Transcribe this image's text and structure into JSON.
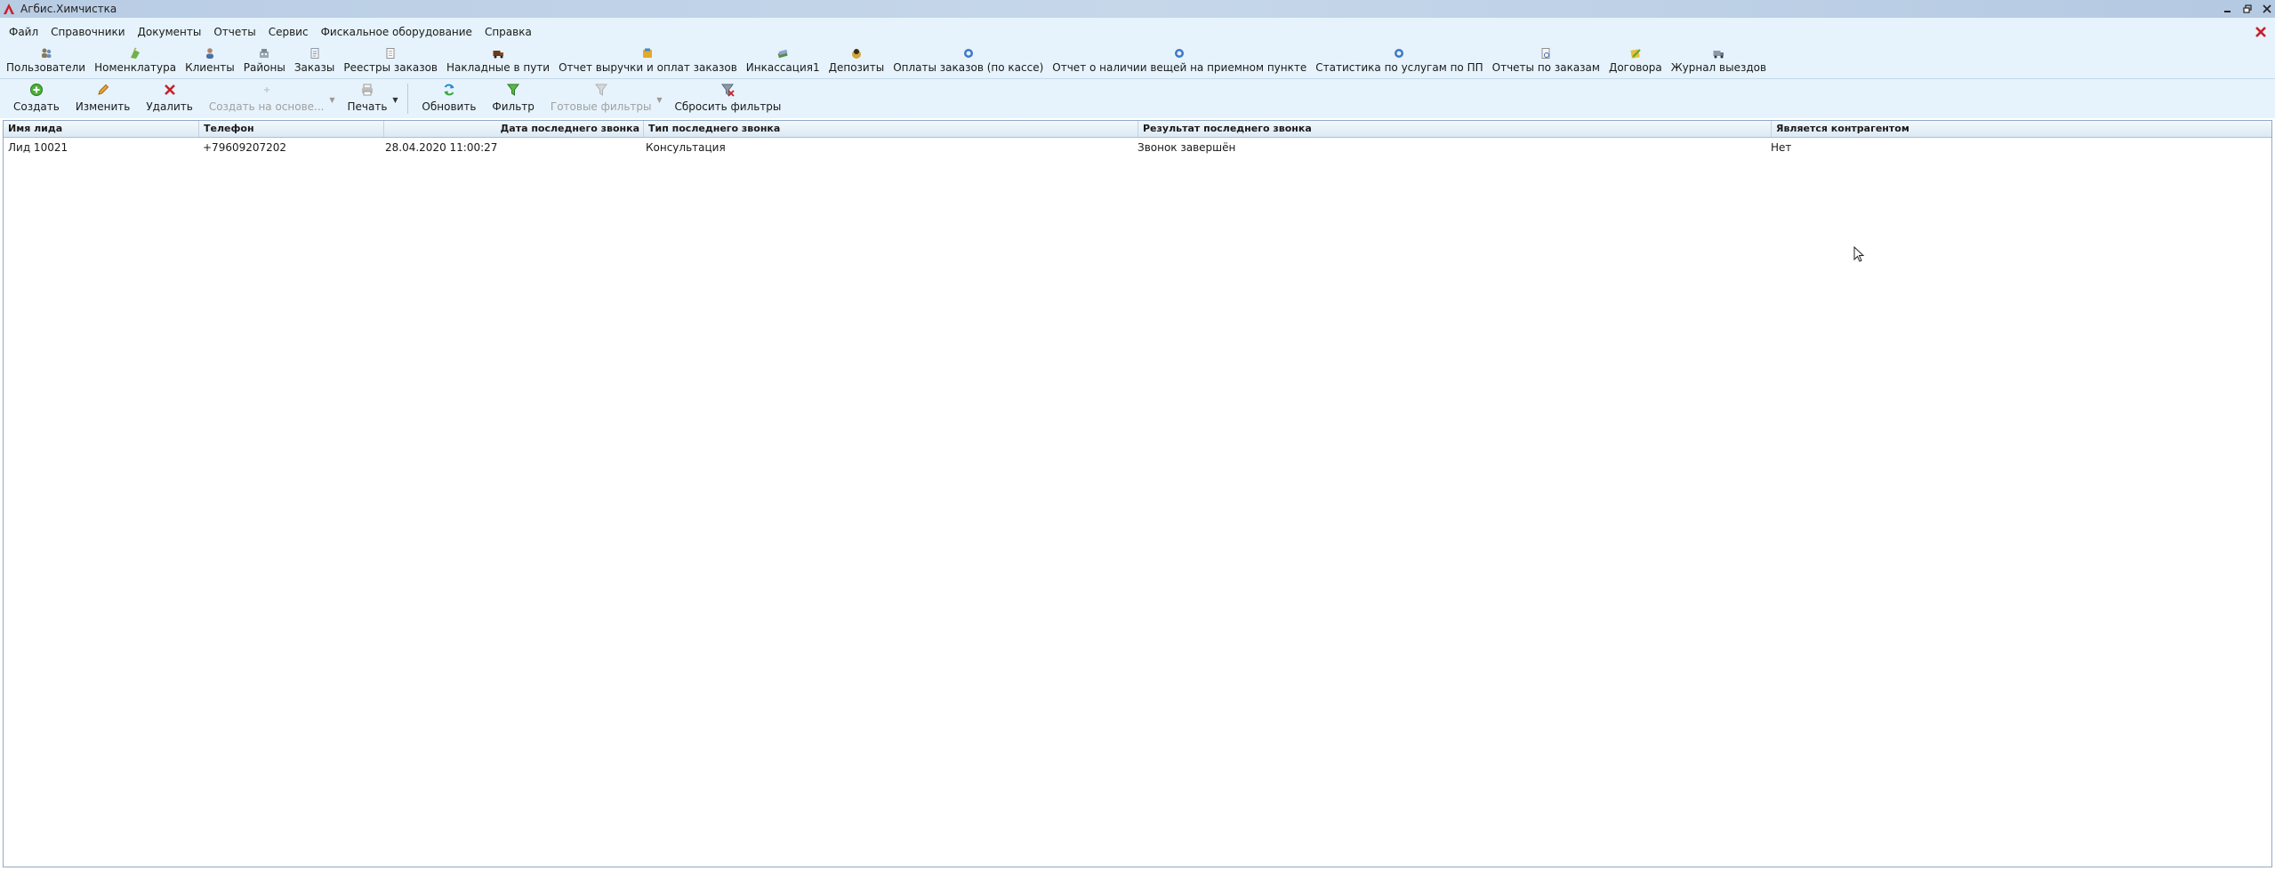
{
  "window": {
    "title": "Агбис.Химчистка"
  },
  "menu": [
    "Файл",
    "Справочники",
    "Документы",
    "Отчеты",
    "Сервис",
    "Фискальное оборудование",
    "Справка"
  ],
  "nav": [
    {
      "label": "Пользователи",
      "icon": "users-icon"
    },
    {
      "label": "Номенклатура",
      "icon": "nomenclature-icon"
    },
    {
      "label": "Клиенты",
      "icon": "clients-icon"
    },
    {
      "label": "Районы",
      "icon": "districts-icon"
    },
    {
      "label": "Заказы",
      "icon": "orders-icon"
    },
    {
      "label": "Реестры заказов",
      "icon": "order-registry-icon"
    },
    {
      "label": "Накладные в пути",
      "icon": "waybills-icon"
    },
    {
      "label": "Отчет выручки и оплат заказов",
      "icon": "revenue-report-icon"
    },
    {
      "label": "Инкассация1",
      "icon": "collection-icon"
    },
    {
      "label": "Депозиты",
      "icon": "deposits-icon"
    },
    {
      "label": "Оплаты заказов (по кассе)",
      "icon": "payments-icon"
    },
    {
      "label": "Отчет о наличии вещей на приемном пункте",
      "icon": "items-report-icon"
    },
    {
      "label": "Статистика по услугам по ПП",
      "icon": "statistics-icon"
    },
    {
      "label": "Отчеты по заказам",
      "icon": "order-reports-icon"
    },
    {
      "label": "Договора",
      "icon": "contracts-icon"
    },
    {
      "label": "Журнал выездов",
      "icon": "trips-journal-icon"
    }
  ],
  "actions": {
    "create": "Создать",
    "edit": "Изменить",
    "delete": "Удалить",
    "create_based": "Создать на основе...",
    "print": "Печать",
    "refresh": "Обновить",
    "filter": "Фильтр",
    "ready_filters": "Готовые фильтры",
    "reset_filters": "Сбросить фильтры"
  },
  "table": {
    "columns": [
      "Имя лида",
      "Телефон",
      "Дата последнего звонка",
      "Тип последнего звонка",
      "Результат последнего звонка",
      "Является контрагентом"
    ],
    "rows": [
      [
        "Лид 10021",
        "+79609207202",
        "28.04.2020 11:00:27",
        "Консультация",
        "Звонок завершён",
        "Нет"
      ]
    ]
  },
  "colors": {
    "accent_red": "#c8202a",
    "toolbar_bg": "#e6f3fc",
    "title_bg": "#c6d7ea",
    "grid_border": "#8faac4"
  }
}
